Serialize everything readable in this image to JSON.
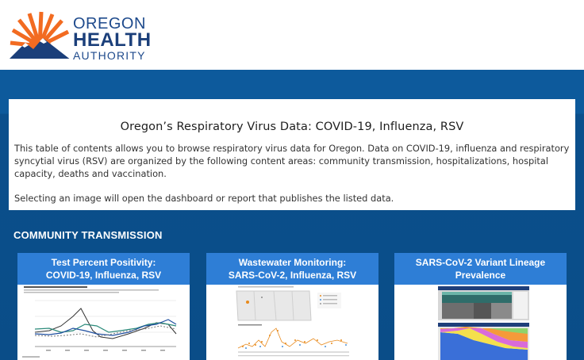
{
  "header": {
    "logo": {
      "line1": "OREGON",
      "line2": "HEALTH",
      "line3": "AUTHORITY",
      "icon": "sun-mountain-logo-icon"
    }
  },
  "intro": {
    "title": "Oregon’s Respiratory Virus Data: COVID-19, Influenza, RSV",
    "paragraph1": "This table of contents allows you to browse respiratory virus data for Oregon. Data on COVID-19, influenza and respiratory syncytial virus (RSV) are organized by the following content areas: community transmission, hospitalizations, hospital capacity, deaths and vaccination.",
    "paragraph2": "Selecting an image will open the dashboard or report that publishes the listed data."
  },
  "section": {
    "title": "COMMUNITY TRANSMISSION",
    "cards": [
      {
        "line1": "Test Percent Positivity:",
        "line2": "COVID-19, Influenza, RSV",
        "thumb": "line-chart-thumbnail"
      },
      {
        "line1": "Wastewater Monitoring:",
        "line2": "SARS-CoV-2, Influenza, RSV",
        "thumb": "map-and-scatter-thumbnail"
      },
      {
        "line1": "SARS-CoV-2 Variant Lineage",
        "line2": "Prevalence",
        "thumb": "stacked-area-thumbnail"
      }
    ]
  },
  "colors": {
    "brand_blue": "#0d5a9c",
    "card_caption": "#2e7ed6",
    "logo_orange": "#f26b21",
    "logo_navy": "#1b3f7a"
  }
}
